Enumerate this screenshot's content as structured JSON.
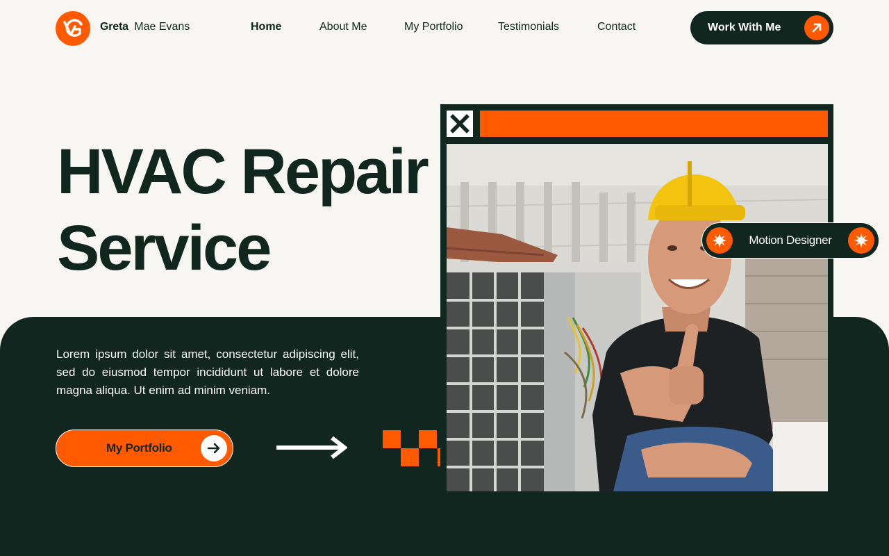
{
  "brand": {
    "first_name": "Greta",
    "rest_name": "Mae Evans",
    "logo_icon": "brand-logo-icon"
  },
  "nav": {
    "items": [
      {
        "label": "Home",
        "active": true
      },
      {
        "label": "About Me",
        "active": false
      },
      {
        "label": "My Portfolio",
        "active": false
      },
      {
        "label": "Testimonials",
        "active": false
      },
      {
        "label": "Contact",
        "active": false
      }
    ]
  },
  "cta": {
    "label": "Work With Me",
    "icon": "arrow-up-right-icon"
  },
  "hero": {
    "title_line1": "HVAC Repair",
    "title_line2": "Service",
    "body": "Lorem ipsum dolor sit amet, consectetur adipiscing elit, sed do eiusmod tempor incididunt ut labore et dolore magna aliqua. Ut enim ad minim veniam.",
    "button_label": "My Portfolio",
    "button_icon": "arrow-right-icon"
  },
  "photo_window": {
    "close_icon": "close-icon",
    "image_alt": "photo-hvac-technician-thumbs-up"
  },
  "tag": {
    "label": "Motion Designer",
    "icon": "starburst-icon"
  },
  "colors": {
    "accent": "#ff5a00",
    "dark": "#10261f",
    "background": "#f8f6f2",
    "white": "#ffffff"
  }
}
